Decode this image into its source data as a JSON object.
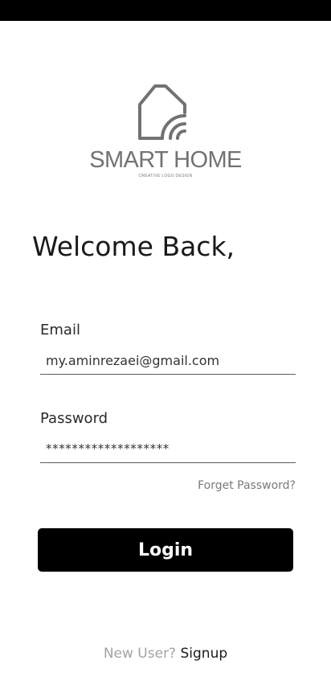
{
  "logo": {
    "icon": "smart-home-logo-icon",
    "title": "SMART HOME",
    "subtitle": "CREATIVE LOGO DESIGN"
  },
  "welcome": "Welcome Back,",
  "form": {
    "email_label": "Email",
    "email_value": "my.aminrezaei@gmail.com",
    "password_label": "Password",
    "password_value": "*******************",
    "forget_label": "Forget Password?",
    "login_label": "Login"
  },
  "footer": {
    "prompt": "New User?",
    "signup_label": "Signup"
  },
  "colors": {
    "primary_button": "#000000",
    "logo_gray": "#727272",
    "muted_text": "#a3a3a3"
  }
}
